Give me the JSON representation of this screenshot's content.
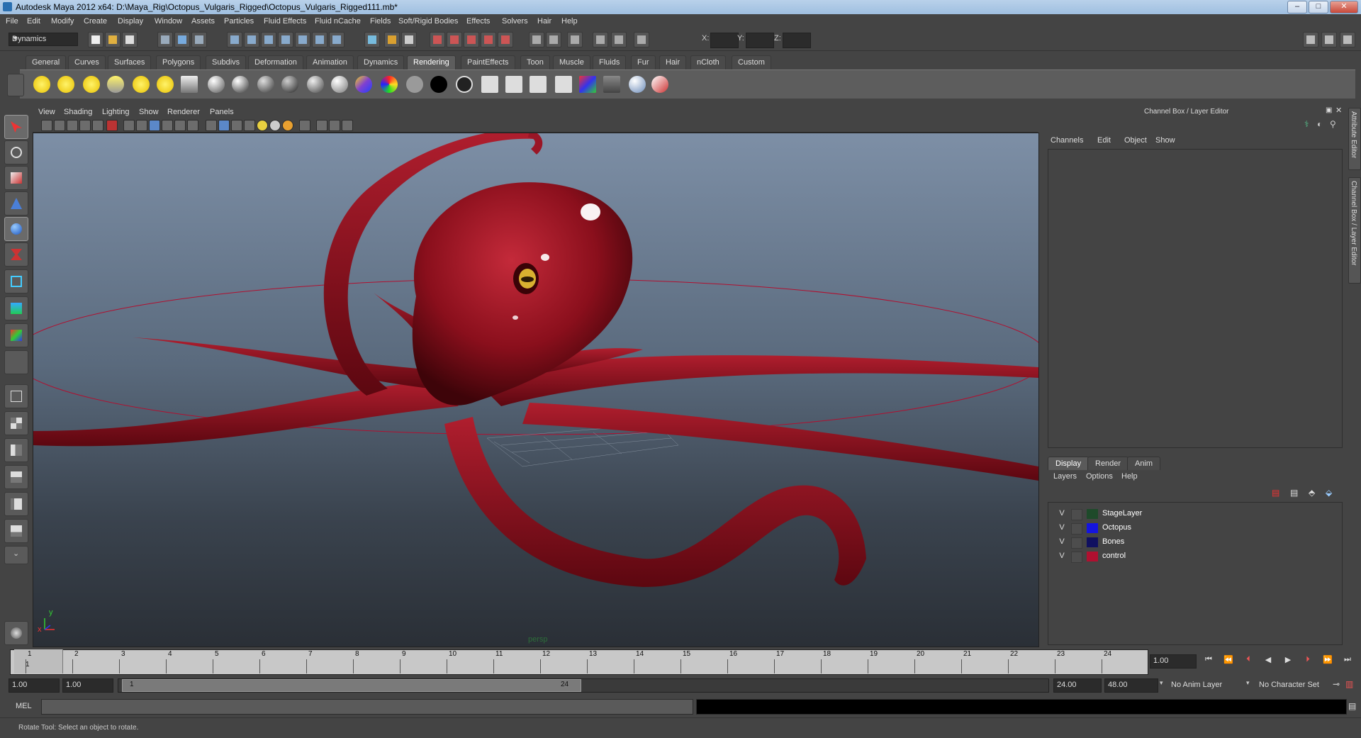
{
  "window": {
    "title": "Autodesk Maya 2012 x64: D:\\Maya_Rig\\Octopus_Vulgaris_Rigged\\Octopus_Vulgaris_Rigged111.mb*",
    "min": "–",
    "max": "□",
    "close": "✕"
  },
  "menu": [
    "File",
    "Edit",
    "Modify",
    "Create",
    "Display",
    "Window",
    "Assets",
    "Particles",
    "Fluid Effects",
    "Fluid nCache",
    "Fields",
    "Soft/Rigid Bodies",
    "Effects",
    "Solvers",
    "Hair",
    "Help"
  ],
  "statusline": {
    "mode": "Dynamics",
    "x_label": "X:",
    "y_label": "Y:",
    "z_label": "Z:"
  },
  "shelf": {
    "tabs": [
      "General",
      "Curves",
      "Surfaces",
      "Polygons",
      "Subdivs",
      "Deformation",
      "Animation",
      "Dynamics",
      "Rendering",
      "PaintEffects",
      "Toon",
      "Muscle",
      "Fluids",
      "Fur",
      "Hair",
      "nCloth",
      "Custom"
    ],
    "active_tab": "Rendering"
  },
  "viewport": {
    "menus": [
      "View",
      "Shading",
      "Lighting",
      "Show",
      "Renderer",
      "Panels"
    ],
    "camera": "persp",
    "axis_x": "x",
    "axis_y": "y"
  },
  "channel_box": {
    "header": "Channel Box / Layer Editor",
    "menus": [
      "Channels",
      "Edit",
      "Object",
      "Show"
    ]
  },
  "layer_editor": {
    "tabs": [
      "Display",
      "Render",
      "Anim"
    ],
    "active_tab": "Display",
    "menus": [
      "Layers",
      "Options",
      "Help"
    ],
    "layers": [
      {
        "visible": "V",
        "name": "StageLayer",
        "color": "#1e4a2a"
      },
      {
        "visible": "V",
        "name": "Octopus",
        "color": "#1414e0"
      },
      {
        "visible": "V",
        "name": "Bones",
        "color": "#101060"
      },
      {
        "visible": "V",
        "name": "control",
        "color": "#b01030"
      }
    ]
  },
  "side_tabs": [
    "Attribute Editor",
    "Channel Box / Layer Editor"
  ],
  "time_slider": {
    "ticks": [
      "1",
      "2",
      "3",
      "4",
      "5",
      "6",
      "7",
      "8",
      "9",
      "10",
      "11",
      "12",
      "13",
      "14",
      "15",
      "16",
      "17",
      "18",
      "19",
      "20",
      "21",
      "22",
      "23",
      "24"
    ],
    "current_marker": "1",
    "current_time": "1.00"
  },
  "range": {
    "start": "1.00",
    "anim_start": "1.00",
    "range_start_label": "1",
    "range_end_label": "24",
    "anim_end": "24.00",
    "end": "48.00",
    "anim_layer": "No Anim Layer",
    "char_set": "No Character Set"
  },
  "command": {
    "lang": "MEL"
  },
  "help_line": "Rotate Tool: Select an object to rotate.",
  "colors": {
    "octopus": "#8a0f1c",
    "accent": "#b01030"
  }
}
